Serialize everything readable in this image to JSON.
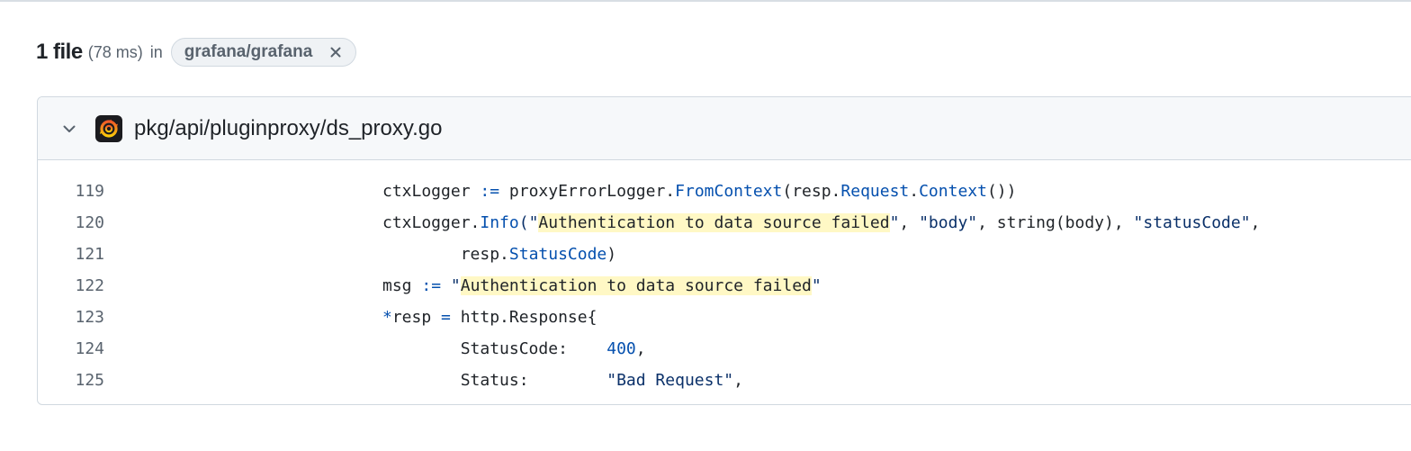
{
  "results": {
    "count": "1 file",
    "timing": "(78 ms)",
    "in_word": "in",
    "repo_filter": "grafana/grafana"
  },
  "file": {
    "path": "pkg/api/pluginproxy/ds_proxy.go",
    "lines": [
      {
        "number": "119",
        "tokens": [
          {
            "t": "\t\t\tctxLogger ",
            "c": ""
          },
          {
            "t": ":=",
            "c": "kw"
          },
          {
            "t": " proxyErrorLogger.",
            "c": ""
          },
          {
            "t": "FromContext",
            "c": "kw"
          },
          {
            "t": "(resp.",
            "c": ""
          },
          {
            "t": "Request",
            "c": "kw"
          },
          {
            "t": ".",
            "c": ""
          },
          {
            "t": "Context",
            "c": "kw"
          },
          {
            "t": "())",
            "c": ""
          }
        ]
      },
      {
        "number": "120",
        "tokens": [
          {
            "t": "\t\t\tctxLogger.",
            "c": ""
          },
          {
            "t": "Info",
            "c": "kw"
          },
          {
            "t": "(\"",
            "c": "str"
          },
          {
            "t": "Authentication to data source failed",
            "c": "hl"
          },
          {
            "t": "\"",
            "c": "str"
          },
          {
            "t": ", ",
            "c": ""
          },
          {
            "t": "\"body\"",
            "c": "str"
          },
          {
            "t": ", string(body), ",
            "c": ""
          },
          {
            "t": "\"statusCode\"",
            "c": "str"
          },
          {
            "t": ",",
            "c": ""
          }
        ]
      },
      {
        "number": "121",
        "tokens": [
          {
            "t": "\t\t\t\tresp.",
            "c": ""
          },
          {
            "t": "StatusCode",
            "c": "kw"
          },
          {
            "t": ")",
            "c": ""
          }
        ]
      },
      {
        "number": "122",
        "tokens": [
          {
            "t": "\t\t\tmsg ",
            "c": ""
          },
          {
            "t": ":=",
            "c": "kw"
          },
          {
            "t": " ",
            "c": ""
          },
          {
            "t": "\"",
            "c": "str"
          },
          {
            "t": "Authentication to data source failed",
            "c": "hl"
          },
          {
            "t": "\"",
            "c": "str"
          }
        ]
      },
      {
        "number": "123",
        "tokens": [
          {
            "t": "\t\t\t",
            "c": ""
          },
          {
            "t": "*",
            "c": "kw"
          },
          {
            "t": "resp ",
            "c": ""
          },
          {
            "t": "=",
            "c": "kw"
          },
          {
            "t": " http.Response{",
            "c": ""
          }
        ]
      },
      {
        "number": "124",
        "tokens": [
          {
            "t": "\t\t\t\tStatusCode:    ",
            "c": ""
          },
          {
            "t": "400",
            "c": "kw"
          },
          {
            "t": ",",
            "c": ""
          }
        ]
      },
      {
        "number": "125",
        "tokens": [
          {
            "t": "\t\t\t\tStatus:        ",
            "c": ""
          },
          {
            "t": "\"Bad Request\"",
            "c": "str"
          },
          {
            "t": ",",
            "c": ""
          }
        ]
      }
    ]
  },
  "icons": {
    "chip_close": "x-icon",
    "collapse": "chevron-down-icon",
    "repo_logo": "grafana-logo-icon"
  },
  "colors": {
    "keyword": "#0550ae",
    "string": "#0a3069",
    "highlight": "#fff8c5",
    "line_number": "#59636e"
  }
}
